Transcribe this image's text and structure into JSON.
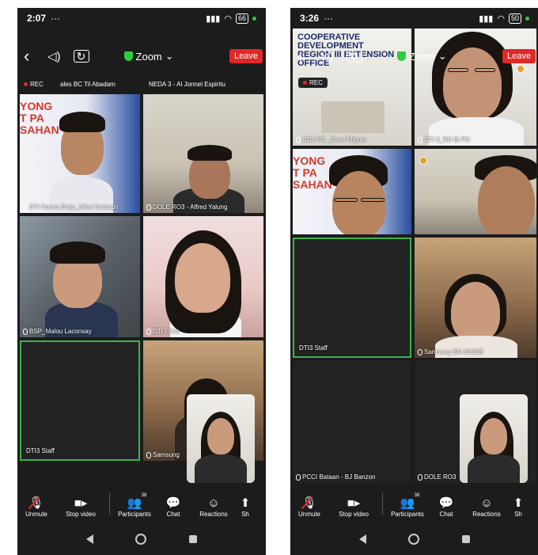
{
  "left_screen": {
    "status": {
      "time": "2:07",
      "dots": "···",
      "battery": "66"
    },
    "top_bar": {
      "meeting": "Zoom",
      "leave": "Leave"
    },
    "rec": "REC",
    "top_strip_names": [
      "ales BC Til Abadam",
      "NEDA 3 - Al Jonnel Espiritu"
    ],
    "banner_text": "YONG\nT PA\nSAHAN",
    "tiles": [
      {
        "label": "DTI Nueva Ecija_Allee Galapon"
      },
      {
        "label": "DOLE RO3 - Alfred Yalung"
      },
      {
        "label": "BSP_Malou Laconsay"
      },
      {
        "label": "DTI3-Kris"
      },
      {
        "label": "DTI3 Staff"
      },
      {
        "label": "Samsung"
      }
    ]
  },
  "right_screen": {
    "status": {
      "time": "3:26",
      "dots": "···",
      "battery": "50"
    },
    "top_bar": {
      "meeting": "Zoom",
      "leave": "Leave"
    },
    "rec": "REC",
    "banner_overlay": "COOPERATIVE DEVELOPMENT\nREGION III EXTENSION OFFICE",
    "banner_text": "YONG\nT PA\nSAHAN",
    "tiles": [
      {
        "label": "CDA R3 _Carol Miguel"
      },
      {
        "label": "DTI 3_RD Bi Pili"
      },
      {
        "label": "DTI3 Staff"
      },
      {
        "label": "Samsung SM-S928B"
      },
      {
        "label": "PCCI Bataan - BJ Banzon"
      },
      {
        "label": "DOLE RO3"
      }
    ]
  },
  "toolbar": {
    "unmute": "Unmute",
    "stop_video": "Stop video",
    "participants": "Participants",
    "participants_count": "38",
    "chat": "Chat",
    "reactions": "Reactions",
    "share": "Sh"
  },
  "icons": {
    "back": "chevron-left-icon",
    "speaker": "speaker-icon",
    "camera_switch": "camera-switch-icon",
    "shield": "shield-icon",
    "mic": "mic-muted-icon",
    "video": "video-icon",
    "participants": "participants-icon",
    "chat": "chat-icon",
    "reactions": "reactions-icon"
  },
  "colors": {
    "leave": "#e02828",
    "active_speaker": "#39b54a",
    "shield": "#2ecc40"
  }
}
